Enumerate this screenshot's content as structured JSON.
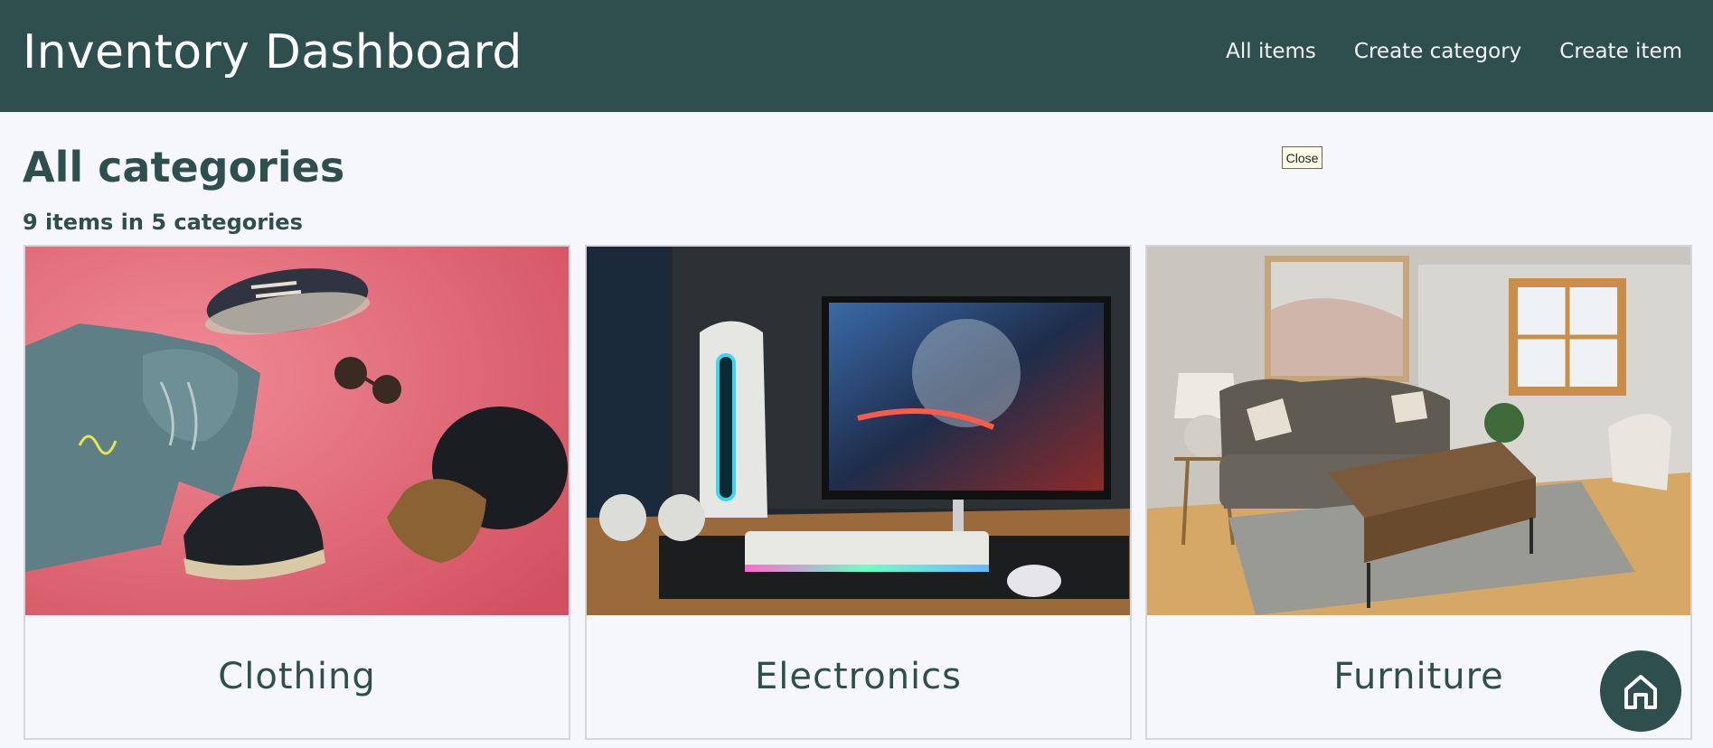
{
  "header": {
    "title": "Inventory Dashboard",
    "nav": [
      {
        "label": "All items"
      },
      {
        "label": "Create category"
      },
      {
        "label": "Create item"
      }
    ]
  },
  "main": {
    "title": "All categories",
    "summary": "9 items in 5 categories",
    "close_label": "Close",
    "categories": [
      {
        "name": "Clothing",
        "image": "clothing-photo"
      },
      {
        "name": "Electronics",
        "image": "electronics-photo"
      },
      {
        "name": "Furniture",
        "image": "furniture-photo"
      }
    ]
  },
  "fab": {
    "icon": "home-icon"
  },
  "colors": {
    "primary": "#2f4f4f",
    "background": "#f6f7fc",
    "card_border": "#d4d6dc"
  }
}
